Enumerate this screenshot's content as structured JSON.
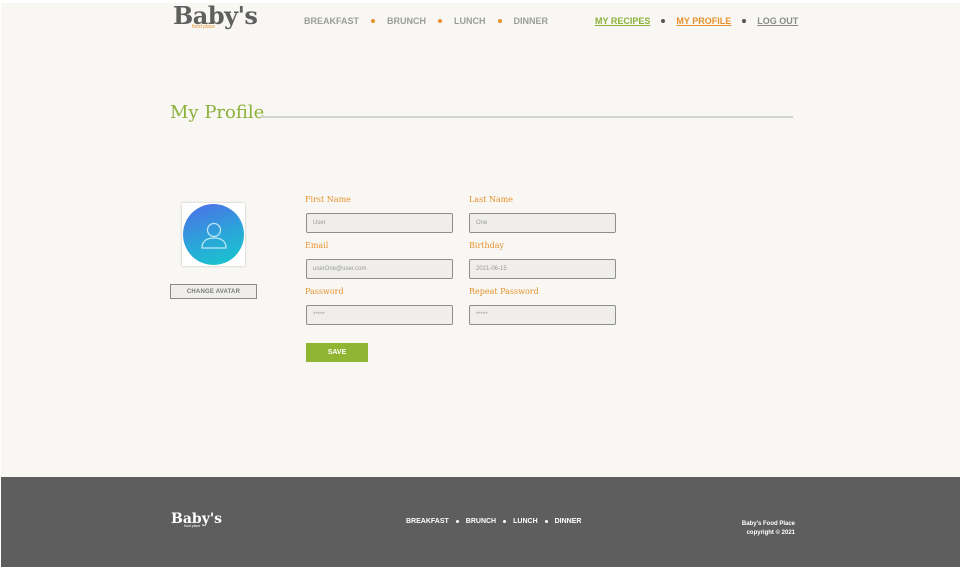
{
  "header": {
    "logo_main": "Baby's",
    "logo_sub": "food place",
    "nav": [
      "BREAKFAST",
      "BRUNCH",
      "LUNCH",
      "DINNER"
    ],
    "user_nav": {
      "my_recipes": "MY RECIPES",
      "my_profile": "MY PROFILE",
      "log_out": "LOG OUT"
    }
  },
  "page": {
    "title": "My Profile"
  },
  "avatar": {
    "icon": "user-icon",
    "change_label": "CHANGE AVATAR"
  },
  "form": {
    "first_name": {
      "label": "First Name",
      "value": "User"
    },
    "last_name": {
      "label": "Last Name",
      "value": "One"
    },
    "email": {
      "label": "Email",
      "value": "userOne@user.com"
    },
    "birthday": {
      "label": "Birthday",
      "value": "2021-06-15"
    },
    "password": {
      "label": "Password",
      "value": "*****"
    },
    "repeat_password": {
      "label": "Repeat Password",
      "value": "*****"
    },
    "save_label": "SAVE"
  },
  "footer": {
    "logo_main": "Baby's",
    "logo_sub": "food place",
    "nav": [
      "BREAKFAST",
      "BRUNCH",
      "LUNCH",
      "DINNER"
    ],
    "copyright_line1": "Baby's Food Place",
    "copyright_line2": "copyright © 2021"
  },
  "colors": {
    "accent_green": "#8cb13a",
    "accent_orange": "#e8922e",
    "footer_bg": "#5e5e5e",
    "page_bg": "#f8f7f3"
  }
}
